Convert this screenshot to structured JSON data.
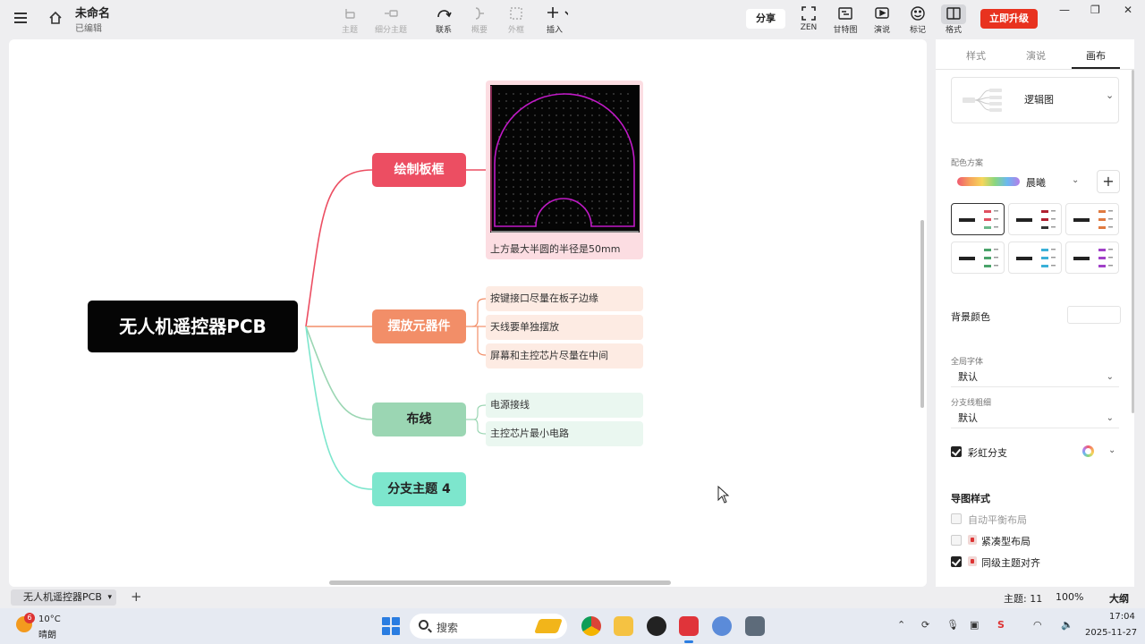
{
  "window": {
    "doc_title": "未命名",
    "doc_status": "已编辑",
    "minimize": "—",
    "maximize": "❐",
    "close": "✕"
  },
  "toolbar": {
    "topic": "主题",
    "subtopic": "细分主题",
    "relationship": "联系",
    "summary": "概要",
    "boundary": "外框",
    "insert": "插入",
    "share": "分享",
    "zen": "ZEN",
    "gantt": "甘特图",
    "present": "演说",
    "marker": "标记",
    "format": "格式",
    "upgrade": "立即升级"
  },
  "mindmap": {
    "root": "无人机遥控器PCB",
    "branches": [
      {
        "label": "绘制板框",
        "color": "#ec4e62"
      },
      {
        "label": "摆放元器件",
        "color": "#f28e68"
      },
      {
        "label": "布线",
        "color": "#9bd6b3"
      },
      {
        "label": "分支主题 4",
        "color": "#7de6cd"
      }
    ],
    "board_caption": "上方最大半圆的半径是50mm",
    "components": [
      "按键接口尽量在板子边缘",
      "天线要单独摆放",
      "屏幕和主控芯片尽量在中间"
    ],
    "routing": [
      "电源接线",
      "主控芯片最小电路"
    ]
  },
  "sheet": {
    "tab_label": "无人机遥控器PCB",
    "add": "+"
  },
  "status": {
    "topic_count": "主题: 11",
    "zoom": "100%",
    "size": "大纲"
  },
  "panel": {
    "tabs": [
      "样式",
      "演说",
      "画布"
    ],
    "structure": "逻辑图",
    "color_scheme_label": "配色方案",
    "color_scheme_name": "晨曦",
    "bg_color_label": "背景颜色",
    "global_font_label": "全局字体",
    "global_font_value": "默认",
    "branch_width_label": "分支线粗细",
    "branch_width_value": "默认",
    "rainbow_branch": "彩虹分支",
    "map_style_label": "导图样式",
    "auto_balance": "自动平衡布局",
    "compact": "紧凑型布局",
    "align_same_level": "同级主题对齐"
  },
  "taskbar": {
    "weather_badge": "6",
    "weather_temp": "10°C",
    "weather_desc": "晴朗",
    "search": "搜索",
    "time": "17:04",
    "date": "2025-11-27"
  }
}
